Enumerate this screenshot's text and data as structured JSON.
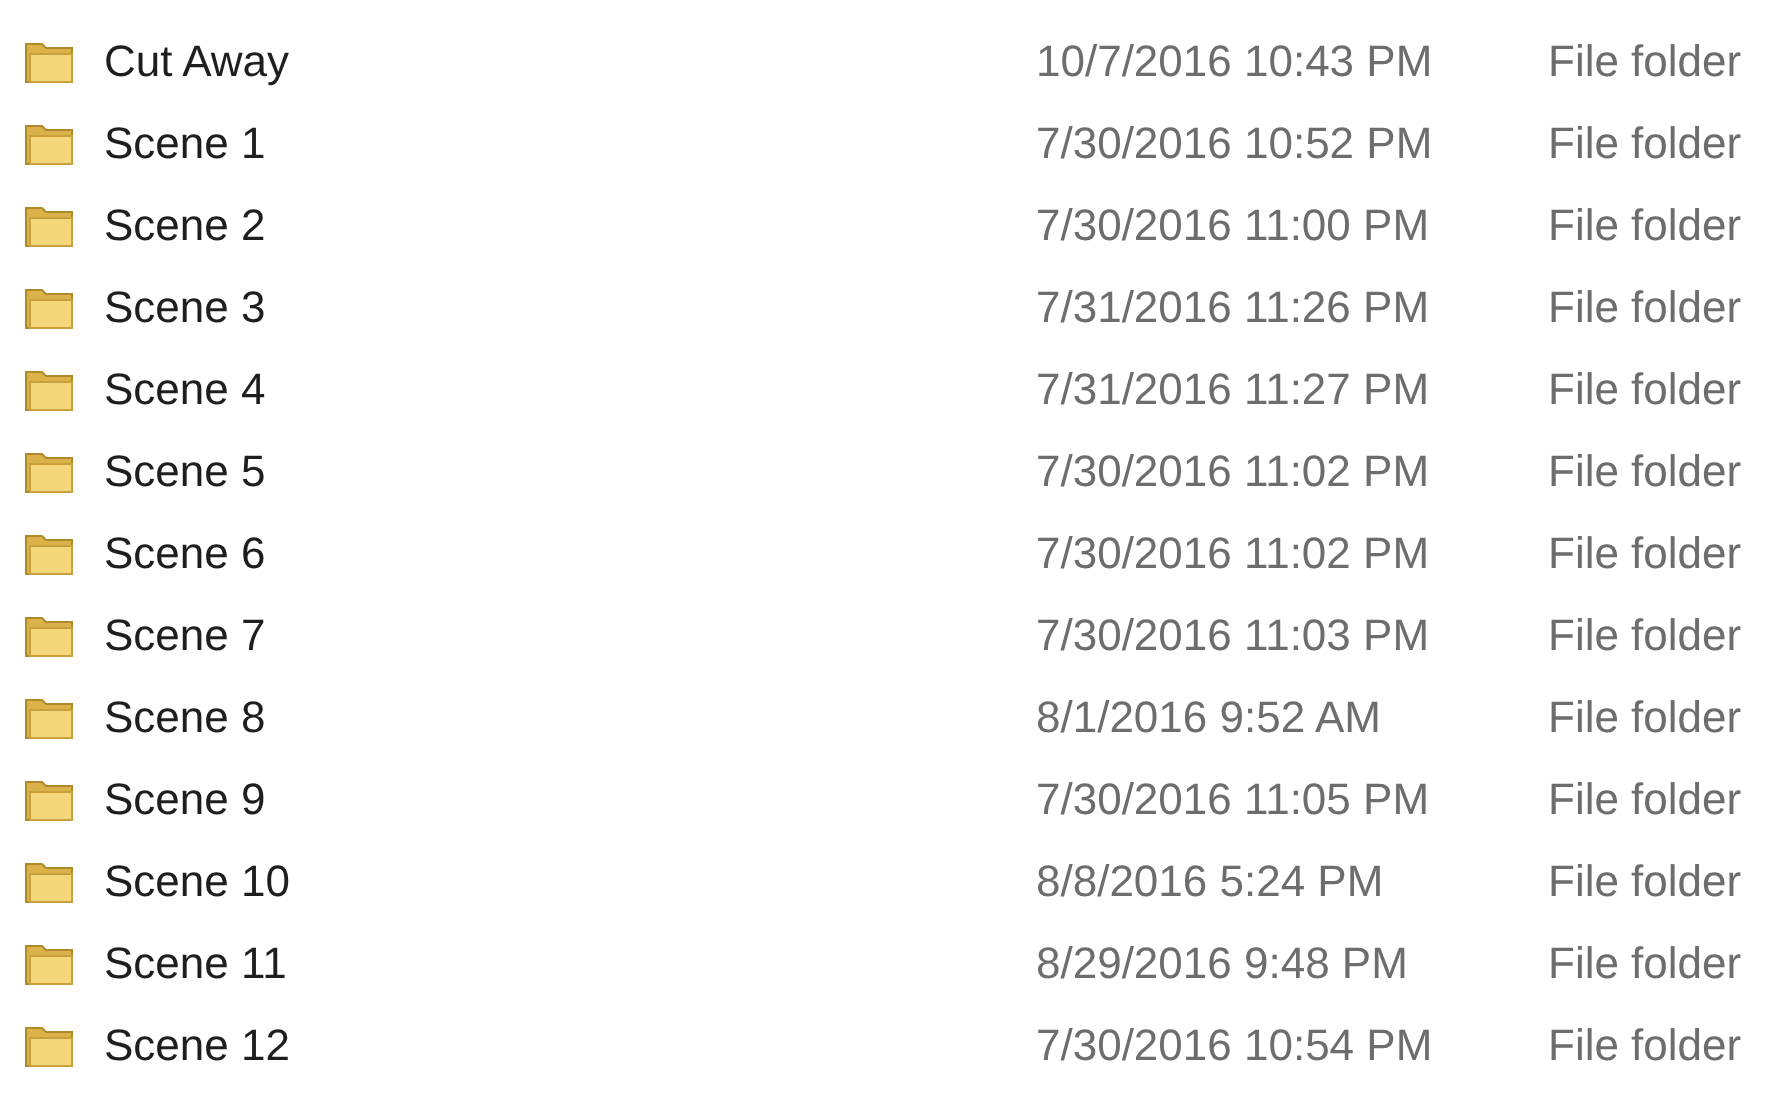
{
  "files": [
    {
      "name": "Cut Away",
      "date_modified": "10/7/2016 10:43 PM",
      "type": "File folder"
    },
    {
      "name": "Scene 1",
      "date_modified": "7/30/2016 10:52 PM",
      "type": "File folder"
    },
    {
      "name": "Scene 2",
      "date_modified": "7/30/2016 11:00 PM",
      "type": "File folder"
    },
    {
      "name": "Scene 3",
      "date_modified": "7/31/2016 11:26 PM",
      "type": "File folder"
    },
    {
      "name": "Scene 4",
      "date_modified": "7/31/2016 11:27 PM",
      "type": "File folder"
    },
    {
      "name": "Scene 5",
      "date_modified": "7/30/2016 11:02 PM",
      "type": "File folder"
    },
    {
      "name": "Scene 6",
      "date_modified": "7/30/2016 11:02 PM",
      "type": "File folder"
    },
    {
      "name": "Scene 7",
      "date_modified": "7/30/2016 11:03 PM",
      "type": "File folder"
    },
    {
      "name": "Scene 8",
      "date_modified": "8/1/2016 9:52 AM",
      "type": "File folder"
    },
    {
      "name": "Scene 9",
      "date_modified": "7/30/2016 11:05 PM",
      "type": "File folder"
    },
    {
      "name": "Scene 10",
      "date_modified": "8/8/2016 5:24 PM",
      "type": "File folder"
    },
    {
      "name": "Scene 11",
      "date_modified": "8/29/2016 9:48 PM",
      "type": "File folder"
    },
    {
      "name": "Scene 12",
      "date_modified": "7/30/2016 10:54 PM",
      "type": "File folder"
    }
  ]
}
